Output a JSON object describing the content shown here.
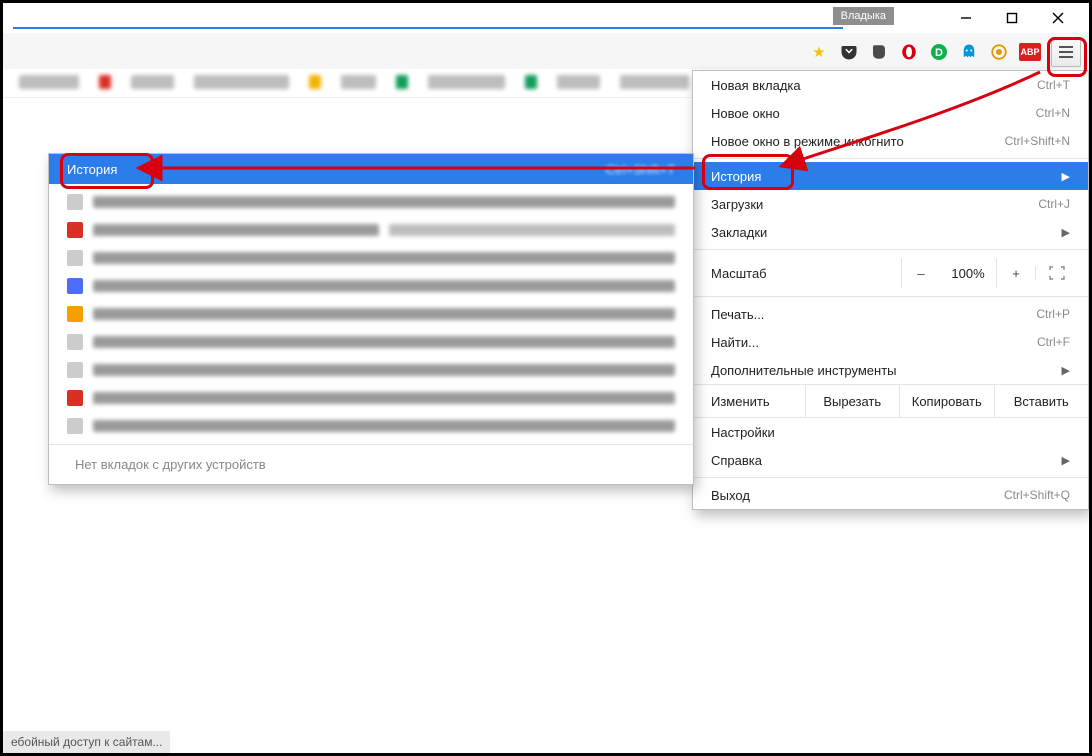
{
  "window": {
    "user_badge": "Владыка"
  },
  "menu": {
    "new_tab": {
      "label": "Новая вкладка",
      "shortcut": "Ctrl+T"
    },
    "new_window": {
      "label": "Новое окно",
      "shortcut": "Ctrl+N"
    },
    "incognito": {
      "label": "Новое окно в режиме инкогнито",
      "shortcut": "Ctrl+Shift+N"
    },
    "history": {
      "label": "История"
    },
    "downloads": {
      "label": "Загрузки",
      "shortcut": "Ctrl+J"
    },
    "bookmarks": {
      "label": "Закладки"
    },
    "zoom": {
      "label": "Масштаб",
      "value": "100%",
      "minus": "–",
      "plus": "+"
    },
    "print": {
      "label": "Печать...",
      "shortcut": "Ctrl+P"
    },
    "find": {
      "label": "Найти...",
      "shortcut": "Ctrl+F"
    },
    "more_tools": {
      "label": "Дополнительные инструменты"
    },
    "edit": {
      "label": "Изменить",
      "cut": "Вырезать",
      "copy": "Копировать",
      "paste": "Вставить"
    },
    "settings": {
      "label": "Настройки"
    },
    "help": {
      "label": "Справка"
    },
    "exit": {
      "label": "Выход",
      "shortcut": "Ctrl+Shift+Q"
    }
  },
  "flyout": {
    "title": "История",
    "reopen_shortcut": "Ctrl+Shift+T",
    "footer": "Нет вкладок с других устройств"
  },
  "status": {
    "text": "ебойный доступ к сайтам..."
  },
  "ext": {
    "abp": "ABP"
  }
}
